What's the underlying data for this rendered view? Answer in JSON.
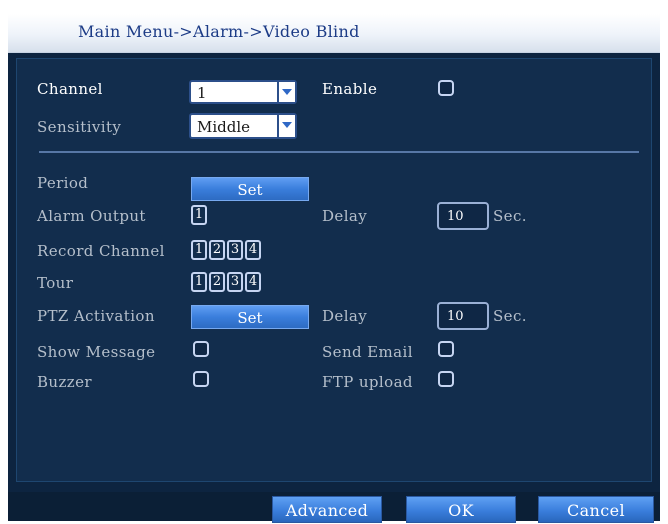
{
  "title": "Main Menu->Alarm->Video Blind",
  "channel": {
    "label": "Channel",
    "value": "1"
  },
  "enable": {
    "label": "Enable"
  },
  "sensitivity": {
    "label": "Sensitivity",
    "value": "Middle"
  },
  "period": {
    "label": "Period",
    "button": "Set"
  },
  "alarm_output": {
    "label": "Alarm Output",
    "boxes": [
      "1"
    ],
    "delay_label": "Delay",
    "delay_value": "10",
    "unit": "Sec."
  },
  "record_channel": {
    "label": "Record Channel",
    "boxes": [
      "1",
      "2",
      "3",
      "4"
    ]
  },
  "tour": {
    "label": "Tour",
    "boxes": [
      "1",
      "2",
      "3",
      "4"
    ]
  },
  "ptz": {
    "label": "PTZ Activation",
    "button": "Set",
    "delay_label": "Delay",
    "delay_value": "10",
    "unit": "Sec."
  },
  "show_message": {
    "label": "Show Message"
  },
  "send_email": {
    "label": "Send Email"
  },
  "buzzer": {
    "label": "Buzzer"
  },
  "ftp_upload": {
    "label": "FTP upload"
  },
  "footer": {
    "advanced": "Advanced",
    "ok": "OK",
    "cancel": "Cancel"
  },
  "colors": {
    "background": "#122d4d",
    "accent": "#3a7edc",
    "title": "#1c3b86"
  }
}
